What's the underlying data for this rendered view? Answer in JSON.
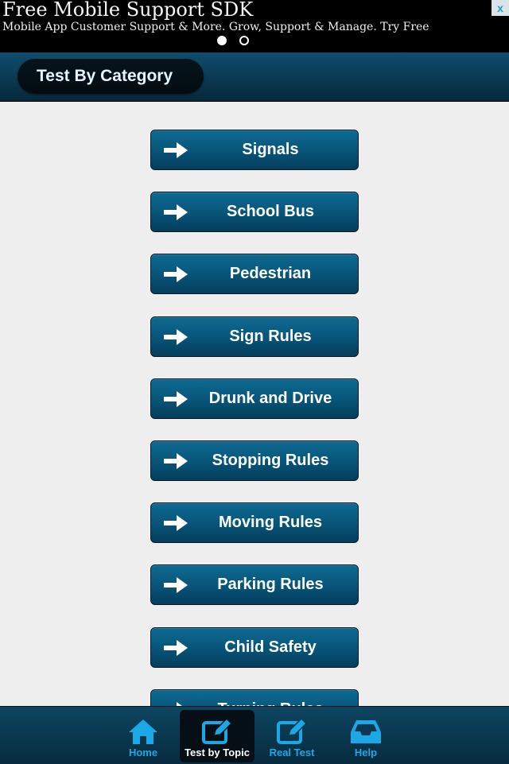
{
  "ad": {
    "title": "Free Mobile Support SDK",
    "subtitle": "Mobile App Customer Support & More. Grow, Support & Manage. Try Free",
    "close_icon": "x",
    "page_dots": [
      true,
      false
    ]
  },
  "header": {
    "title": "Test By Category"
  },
  "categories": [
    {
      "label": "Signals"
    },
    {
      "label": "School Bus"
    },
    {
      "label": "Pedestrian"
    },
    {
      "label": "Sign Rules"
    },
    {
      "label": "Drunk and Drive"
    },
    {
      "label": "Stopping Rules"
    },
    {
      "label": "Moving Rules"
    },
    {
      "label": "Parking Rules"
    },
    {
      "label": "Child Safety"
    },
    {
      "label": "Turning Rules"
    }
  ],
  "tabbar": {
    "tabs": [
      {
        "label": "Home",
        "icon": "home-icon",
        "active": false
      },
      {
        "label": "Test by Topic",
        "icon": "edit-icon",
        "active": true
      },
      {
        "label": "Real Test",
        "icon": "edit-icon",
        "active": false
      },
      {
        "label": "Help",
        "icon": "inbox-icon",
        "active": false
      }
    ]
  },
  "colors": {
    "accent": "#1aa9e6",
    "button": "#075478",
    "background": "#eeeeee"
  }
}
